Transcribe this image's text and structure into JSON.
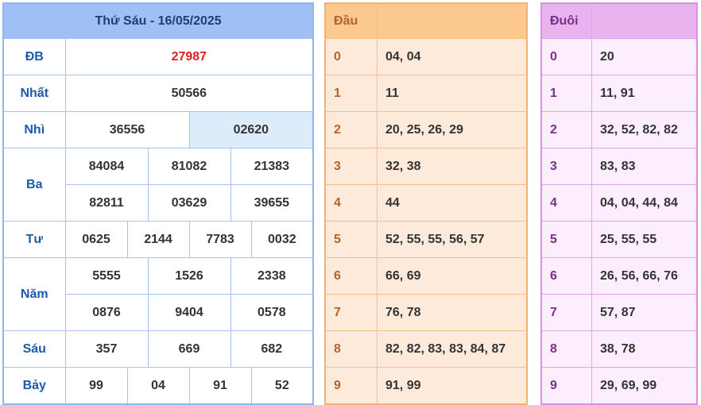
{
  "result": {
    "title": "Thứ Sáu - 16/05/2025",
    "prizes": {
      "db": {
        "label": "ĐB",
        "values": [
          "27987"
        ]
      },
      "nhat": {
        "label": "Nhất",
        "values": [
          "50566"
        ]
      },
      "nhi": {
        "label": "Nhì",
        "values": [
          "36556",
          "02620"
        ]
      },
      "ba": {
        "label": "Ba",
        "values": [
          "84084",
          "81082",
          "21383",
          "82811",
          "03629",
          "39655"
        ]
      },
      "tu": {
        "label": "Tư",
        "values": [
          "0625",
          "2144",
          "7783",
          "0032"
        ]
      },
      "nam": {
        "label": "Năm",
        "values": [
          "5555",
          "1526",
          "2338",
          "0876",
          "9404",
          "0578"
        ]
      },
      "sau": {
        "label": "Sáu",
        "values": [
          "357",
          "669",
          "682"
        ]
      },
      "bay": {
        "label": "Bảy",
        "values": [
          "99",
          "04",
          "91",
          "52"
        ]
      }
    }
  },
  "dau": {
    "header": "Đầu",
    "rows": [
      {
        "digit": "0",
        "values": "04, 04"
      },
      {
        "digit": "1",
        "values": "11"
      },
      {
        "digit": "2",
        "values": "20, 25, 26, 29"
      },
      {
        "digit": "3",
        "values": "32, 38"
      },
      {
        "digit": "4",
        "values": "44"
      },
      {
        "digit": "5",
        "values": "52, 55, 55, 56, 57"
      },
      {
        "digit": "6",
        "values": "66, 69"
      },
      {
        "digit": "7",
        "values": "76, 78"
      },
      {
        "digit": "8",
        "values": "82, 82, 83, 83, 84, 87"
      },
      {
        "digit": "9",
        "values": "91, 99"
      }
    ]
  },
  "duoi": {
    "header": "Đuôi",
    "rows": [
      {
        "digit": "0",
        "values": "20"
      },
      {
        "digit": "1",
        "values": "11, 91"
      },
      {
        "digit": "2",
        "values": "32, 52, 82, 82"
      },
      {
        "digit": "3",
        "values": "83, 83"
      },
      {
        "digit": "4",
        "values": "04, 04, 44, 84"
      },
      {
        "digit": "5",
        "values": "25, 55, 55"
      },
      {
        "digit": "6",
        "values": "26, 56, 66, 76"
      },
      {
        "digit": "7",
        "values": "57, 87"
      },
      {
        "digit": "8",
        "values": "38, 78"
      },
      {
        "digit": "9",
        "values": "29, 69, 99"
      }
    ]
  },
  "colors": {
    "result_header_bg": "#9fbff5",
    "label_blue": "#1f5aa8",
    "special_prize_red": "#e0201e",
    "dau_bg": "#fdeadb",
    "dau_header_bg": "#fbc98e",
    "duoi_bg": "#fceefd",
    "duoi_header_bg": "#e8b3ef"
  }
}
